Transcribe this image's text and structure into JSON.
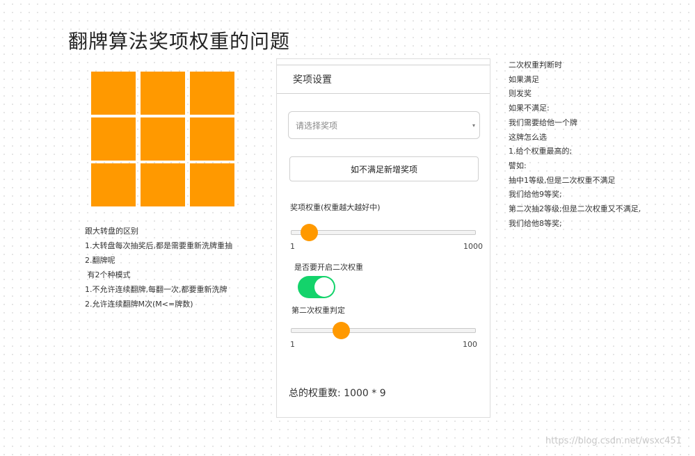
{
  "page": {
    "title": "翻牌算法奖项权重的问题",
    "watermark": "https://blog.csdn.net/wsxc451"
  },
  "tiles": {
    "count": 9,
    "color": "#ff9900"
  },
  "notes_left": [
    "跟大转盘的区别",
    "1.大转盘每次抽奖后,都是需要重新洗牌重抽",
    "2.翻牌呢",
    " 有2个种模式",
    "1.不允许连续翻牌,每翻一次,都要重新洗牌",
    "2.允许连续翻牌M次(M<=牌数)"
  ],
  "notes_right": [
    "二次权重判断时",
    "如果满足",
    "则发奖",
    "如果不满足:",
    "我们需要给他一个牌",
    "这牌怎么选",
    "1.给个权重最高的;",
    "譬如:",
    "抽中1等级,但是二次权重不满足",
    "我们给他9等奖;",
    "第二次抽2等级;但是二次权重又不满足,",
    "我们给他8等奖;"
  ],
  "panel": {
    "header": "奖项设置",
    "select": {
      "placeholder": "请选择奖项",
      "caret_icon": "▾"
    },
    "add_button": "如不满足新增奖项",
    "weight_slider": {
      "label": "奖项权重(权重越大越好中)",
      "min": 1,
      "max": 1000,
      "value": 100,
      "min_label": "1",
      "max_label": "1000"
    },
    "second_weight_toggle": {
      "label": "是否要开启二次权重",
      "on": true,
      "color": "#14d36b"
    },
    "second_weight_slider": {
      "label": "第二次权重判定",
      "min": 1,
      "max": 100,
      "value": 28,
      "min_label": "1",
      "max_label": "100"
    },
    "total": "总的权重数: 1000 * 9"
  }
}
